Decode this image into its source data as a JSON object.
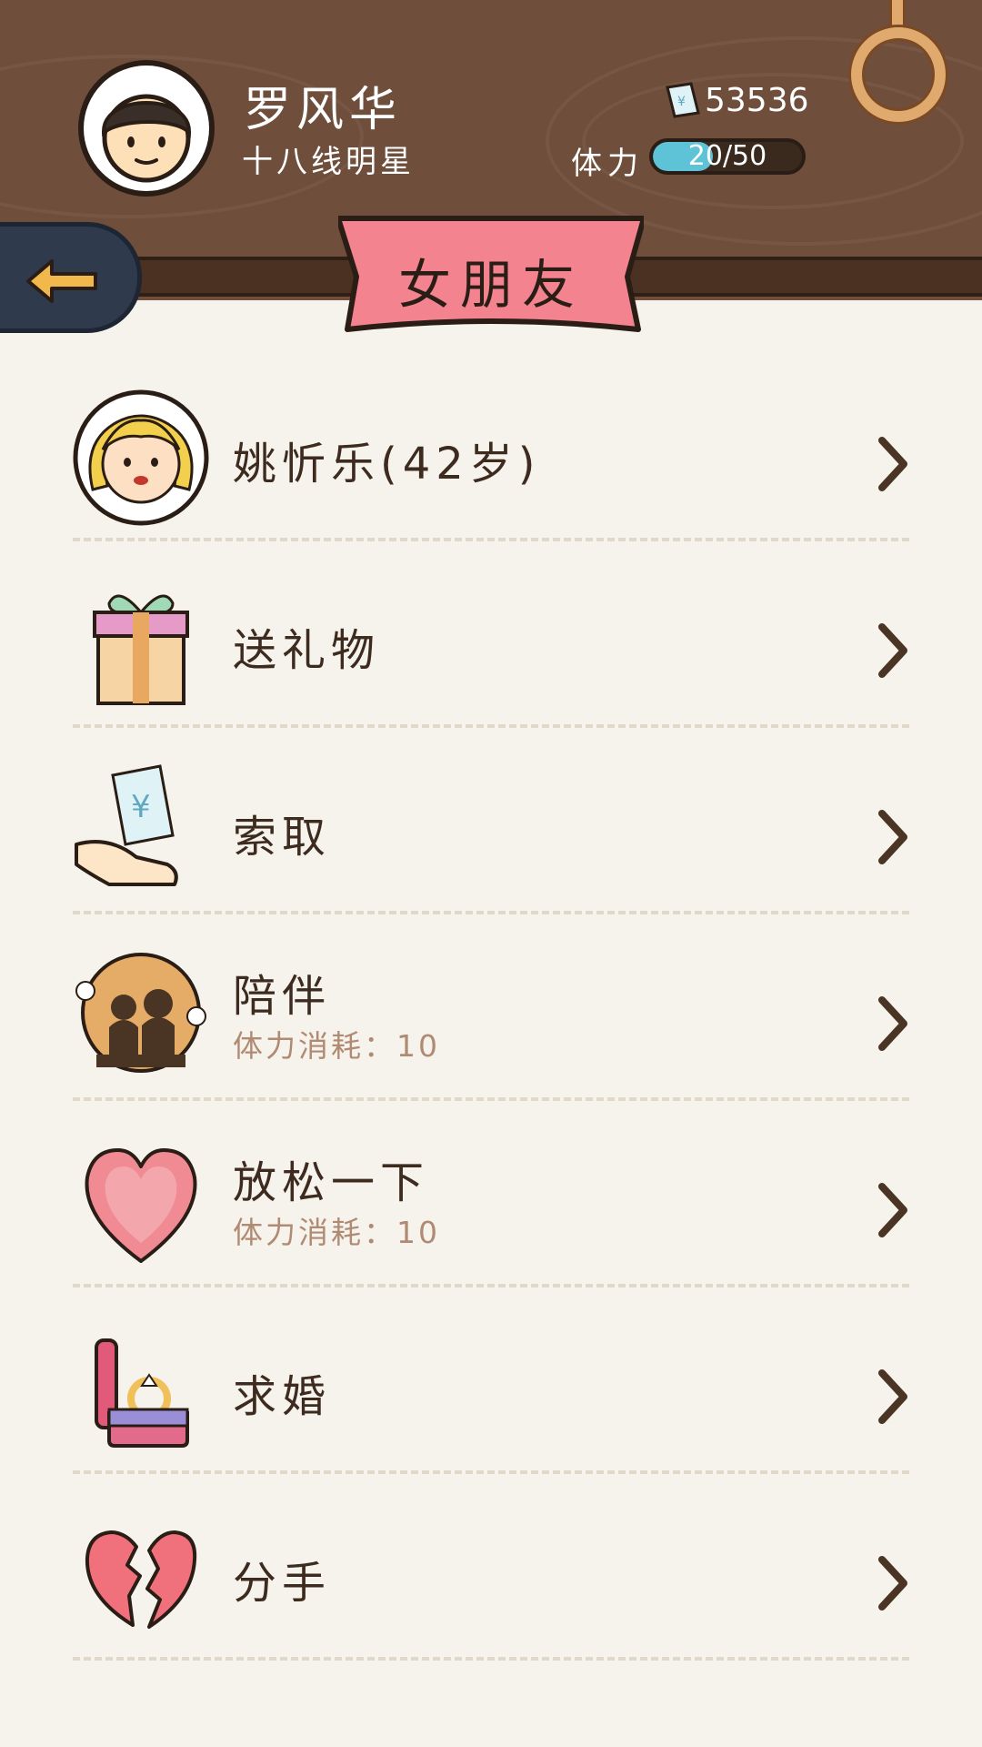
{
  "header": {
    "player_name": "罗风华",
    "player_title": "十八线明星",
    "money": "53536",
    "stamina_label": "体力",
    "stamina_text": "20/50",
    "stamina_fraction": 0.4,
    "page_title": "女朋友"
  },
  "menu": {
    "items": [
      {
        "label": "姚忻乐(42岁)",
        "icon": "girlfriend-avatar-icon"
      },
      {
        "label": "送礼物",
        "icon": "gift-icon"
      },
      {
        "label": "索取",
        "icon": "money-hand-icon"
      },
      {
        "label": "陪伴",
        "sub": "体力消耗：10",
        "icon": "couple-icon"
      },
      {
        "label": "放松一下",
        "sub": "体力消耗：10",
        "icon": "heart-icon"
      },
      {
        "label": "求婚",
        "icon": "ring-box-icon"
      },
      {
        "label": "分手",
        "icon": "broken-heart-icon"
      }
    ]
  },
  "colors": {
    "header_bg": "#6f4e3b",
    "page_bg": "#f6f3ec",
    "banner": "#f2838f",
    "stamina": "#5fc3d8",
    "back_button": "#2f3a4d",
    "sub_text": "#b08a72"
  }
}
